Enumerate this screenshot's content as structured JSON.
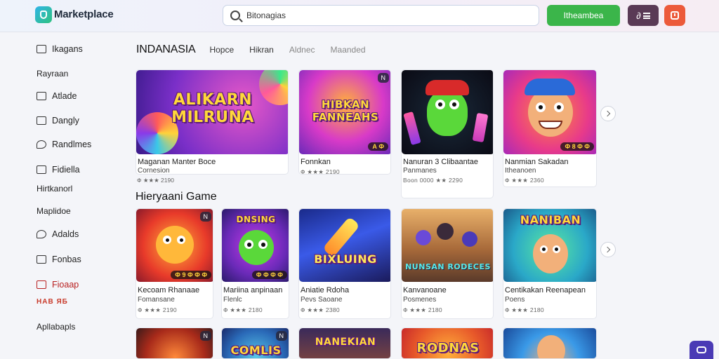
{
  "header": {
    "app_title": "Marketplace",
    "search_value": "Bitonagias",
    "green_button": "Itheambea",
    "dark_button_glyph": "∂"
  },
  "sidebar": {
    "items": [
      {
        "label": "Ikagans",
        "icon": "grid-icon"
      },
      {
        "label": "Rayraan",
        "icon": ""
      },
      {
        "label": "Atlade",
        "icon": "image-icon"
      },
      {
        "label": "Dangly",
        "icon": "mail-icon"
      },
      {
        "label": "Randlmes",
        "icon": "chat-icon"
      },
      {
        "label": "Fidiella",
        "icon": "doc-icon"
      },
      {
        "label": "Hirtkanorl",
        "icon": ""
      },
      {
        "label": "Maplidoe",
        "icon": ""
      },
      {
        "label": "Adalds",
        "icon": "chat-icon"
      },
      {
        "label": "Fonbas",
        "icon": "mail-icon"
      },
      {
        "label": "Fioaap",
        "icon": "box-icon"
      },
      {
        "label": "НАВ ЯБ",
        "icon": ""
      },
      {
        "label": "Apllabapls",
        "icon": ""
      }
    ]
  },
  "tabs": {
    "main": "INDANASIA",
    "items": [
      "Hopce",
      "Hikran",
      "Aldnec",
      "Maanded"
    ]
  },
  "section2_title": "Hieryaani Game",
  "row1": [
    {
      "thumb_title": "ALIKARN MILRUNA",
      "title": "Maganan Manter Boce",
      "subtitle": "Cornesion",
      "meta": "Ф ★★★ 2190",
      "badge": ""
    },
    {
      "thumb_title": "HIBKAN FANNEAHS",
      "title": "Fonnkan",
      "subtitle": "",
      "meta": "Ф ★★★ 2190",
      "badge": "N",
      "pill": "А Ф"
    },
    {
      "thumb_title": "",
      "title": "Nanuran 3 Clibaantae",
      "subtitle": "Panmanes",
      "meta": "Boon 0000 ★★ 2290",
      "badge": ""
    },
    {
      "thumb_title": "",
      "title": "Nanmian Sakadan",
      "subtitle": "Itheanoen",
      "meta": "Ф ★★★ 2360",
      "badge": "",
      "pill": "Ф 8 Ф Ф"
    }
  ],
  "row2": [
    {
      "thumb_title": "",
      "title": "Kecoam Rhanaae",
      "subtitle": "Fomansane",
      "meta": "Ф ★★★ 2190",
      "badge": "N",
      "pill": "Ф 9 Ф Ф Ф"
    },
    {
      "thumb_title": "DNSING",
      "title": "Mariina anpinaan",
      "subtitle": "Flenlc",
      "meta": "Ф ★★★ 2180",
      "badge": "",
      "pill": "Ф Ф Ф Ф"
    },
    {
      "thumb_title": "BIXLUING",
      "title": "Aniatie Rdoha",
      "subtitle": "Pevs Saoane",
      "meta": "Ф ★★★ 2380",
      "badge": ""
    },
    {
      "thumb_title": "NUNSAN RODECES",
      "title": "Kanvanoane",
      "subtitle": "Posmenes",
      "meta": "Ф ★★★ 2180",
      "badge": ""
    },
    {
      "thumb_title": "NANIBAN",
      "title": "Centikakan Reenapean",
      "subtitle": "Poens",
      "meta": "Ф ★★★ 2180",
      "badge": ""
    }
  ],
  "row3": [
    {
      "thumb_title": "",
      "badge": "N"
    },
    {
      "thumb_title": "COMLIS",
      "badge": "N"
    },
    {
      "thumb_title": "NANEKIAN",
      "badge": ""
    },
    {
      "thumb_title": "RODNAS",
      "badge": ""
    },
    {
      "thumb_title": "",
      "badge": ""
    }
  ],
  "colors": {
    "green": "#3bb54a",
    "dark": "#5a3a55",
    "red": "#ec5a3a",
    "purple": "#4a3ab5"
  }
}
